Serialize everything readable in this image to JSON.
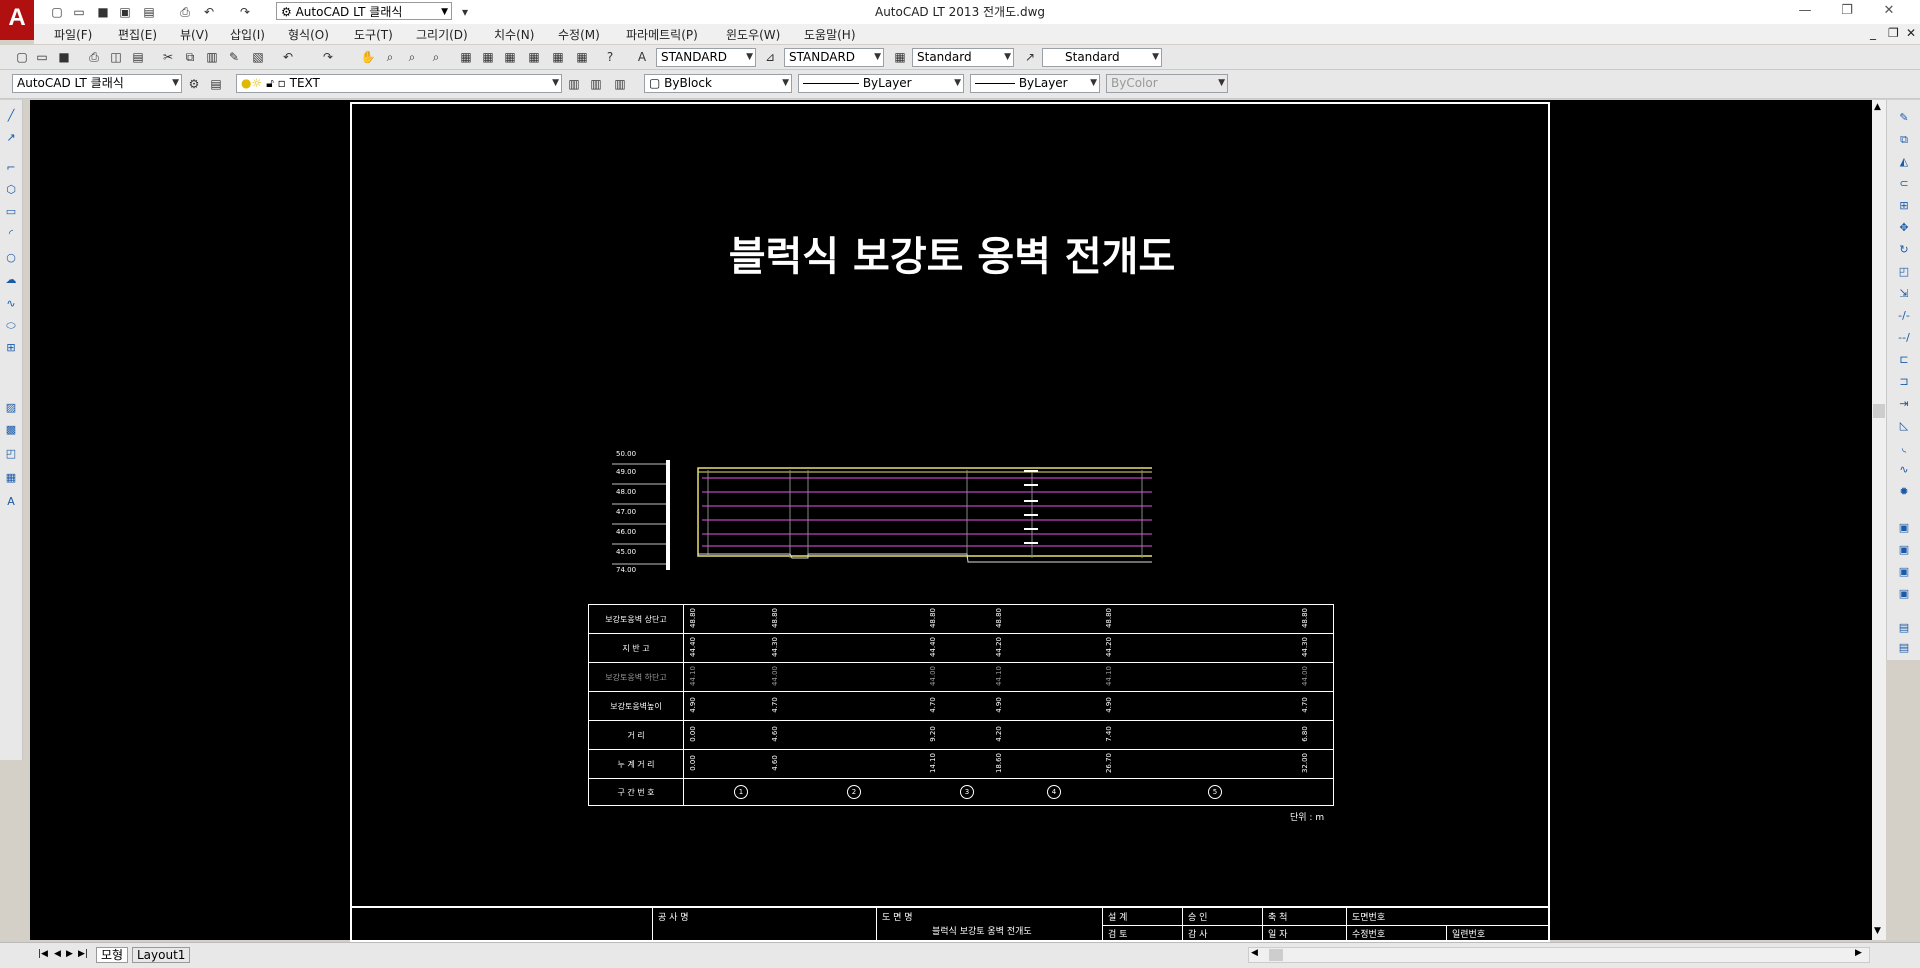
{
  "window": {
    "title": "AutoCAD LT 2013    전개도.dwg",
    "workspace": "AutoCAD LT 클래식",
    "logo": "A"
  },
  "menu": [
    "파일(F)",
    "편집(E)",
    "뷰(V)",
    "삽입(I)",
    "형식(O)",
    "도구(T)",
    "그리기(D)",
    "치수(N)",
    "수정(M)",
    "파라메트릭(P)",
    "윈도우(W)",
    "도움말(H)"
  ],
  "styles": {
    "text_style": "STANDARD",
    "dim_style": "STANDARD",
    "table_style": "Standard",
    "mleader_style": "Standard"
  },
  "properties": {
    "workspace_combo": "AutoCAD LT 클래식",
    "layer": "TEXT",
    "color": "ByBlock",
    "linetype": "ByLayer",
    "lineweight": "ByLayer",
    "plotstyle": "ByColor"
  },
  "layout_tabs": [
    "모형",
    "Layout1"
  ],
  "drawing": {
    "title": "블럭식 보강토 옹벽 전개도",
    "units_note": "단위 : m",
    "scale_labels": [
      "50.00",
      "49.00",
      "48.00",
      "47.00",
      "46.00",
      "45.00",
      "74.00"
    ],
    "table_rows": [
      "보강토옹벽 상단고",
      "지 반 고",
      "보강토옹벽 하단고",
      "보강토옹벽높이",
      "거 리",
      "누 계 거 리",
      "구 간 번 호"
    ],
    "segment_numbers": [
      "1",
      "2",
      "3",
      "4",
      "5"
    ],
    "columns": [
      {
        "top": "48.80",
        "ground": "44.40",
        "bottom": "44.10",
        "height": "4.90",
        "dist": "0.00",
        "cum": "0.00"
      },
      {
        "top": "48.80",
        "ground": "44.30",
        "bottom": "44.00",
        "height": "4.70",
        "dist": "4.60",
        "cum": "4.60"
      },
      {
        "top": "48.80",
        "ground": "44.40",
        "bottom": "44.00",
        "height": "4.70",
        "dist": "9.20",
        "cum": "14.10"
      },
      {
        "top": "48.80",
        "ground": "44.20",
        "bottom": "44.10",
        "height": "4.90",
        "dist": "4.20",
        "cum": "18.60"
      },
      {
        "top": "48.80",
        "ground": "44.20",
        "bottom": "44.10",
        "height": "4.90",
        "dist": "7.40",
        "cum": "26.70"
      },
      {
        "top": "48.80",
        "ground": "44.30",
        "bottom": "44.00",
        "height": "4.70",
        "dist": "6.80",
        "cum": "32.00"
      }
    ],
    "title_block": {
      "project_label": "공 사 명",
      "drawing_label": "도 면 명",
      "drawing_name": "블럭식 보강토 옹벽 전개도",
      "cells": [
        "설 계",
        "검 토",
        "승 인",
        "감 사",
        "축 척",
        "일 자",
        "도면번호",
        "수정번호",
        "일련번호"
      ]
    }
  }
}
